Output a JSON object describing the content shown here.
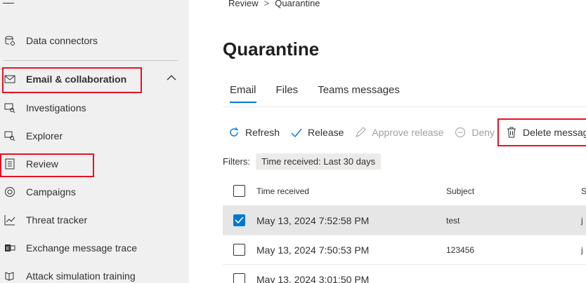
{
  "sidebar": {
    "items": [
      {
        "label": "Data connectors",
        "icon": "database-icon"
      },
      {
        "label": "Email & collaboration",
        "icon": "mail-icon"
      },
      {
        "label": "Investigations",
        "icon": "investigation-icon"
      },
      {
        "label": "Explorer",
        "icon": "explorer-icon"
      },
      {
        "label": "Review",
        "icon": "review-icon"
      },
      {
        "label": "Campaigns",
        "icon": "target-icon"
      },
      {
        "label": "Threat tracker",
        "icon": "chart-line-icon"
      },
      {
        "label": "Exchange message trace",
        "icon": "exchange-icon"
      },
      {
        "label": "Attack simulation training",
        "icon": "phishing-icon"
      }
    ]
  },
  "breadcrumb": {
    "parent": "Review",
    "separator": ">",
    "current": "Quarantine"
  },
  "page": {
    "title": "Quarantine"
  },
  "tabs": [
    {
      "label": "Email"
    },
    {
      "label": "Files"
    },
    {
      "label": "Teams messages"
    }
  ],
  "toolbar": {
    "refresh": "Refresh",
    "release": "Release",
    "approve_release": "Approve release",
    "deny": "Deny",
    "delete": "Delete message"
  },
  "filters": {
    "label": "Filters:",
    "pill_key": "Time received:",
    "pill_value": "Last 30 days"
  },
  "table": {
    "columns": {
      "time": "Time received",
      "subject": "Subject",
      "sender": "S"
    },
    "rows": [
      {
        "time": "May 13, 2024 7:52:58 PM",
        "subject": "test",
        "sender": "j",
        "checked": true
      },
      {
        "time": "May 13, 2024 7:50:53 PM",
        "subject": "123456",
        "sender": "j",
        "checked": false
      },
      {
        "time": "May 13, 2024 3:01:50 PM",
        "subject": "",
        "sender": "",
        "checked": false
      }
    ]
  },
  "colors": {
    "accent": "#0078d4",
    "highlight": "#e81123"
  }
}
